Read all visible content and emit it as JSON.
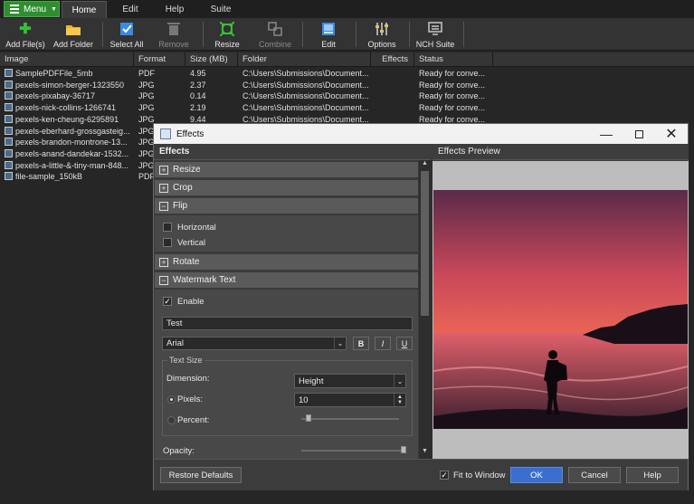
{
  "menubar": {
    "menu_label": "Menu",
    "tabs": [
      "Home",
      "Edit",
      "Help",
      "Suite"
    ]
  },
  "toolbar": {
    "buttons": [
      {
        "label": "Add File(s)",
        "icon": "add-icon",
        "enabled": true,
        "color": "#34c234"
      },
      {
        "label": "Add Folder",
        "icon": "folder-icon",
        "enabled": true,
        "color": "#f0b429"
      },
      {
        "label": "Select All",
        "icon": "select-all-icon",
        "enabled": true,
        "color": "#3a8be0"
      },
      {
        "label": "Remove",
        "icon": "remove-icon",
        "enabled": false,
        "color": "#8a8a8a"
      },
      {
        "label": "Resize",
        "icon": "resize-icon",
        "enabled": true,
        "color": "#34c234"
      },
      {
        "label": "Combine",
        "icon": "combine-icon",
        "enabled": false,
        "color": "#8a8a8a"
      },
      {
        "label": "Edit",
        "icon": "edit-icon",
        "enabled": true,
        "color": "#3a8be0"
      },
      {
        "label": "Options",
        "icon": "options-icon",
        "enabled": true,
        "color": "#d8c070"
      },
      {
        "label": "NCH Suite",
        "icon": "suite-icon",
        "enabled": true,
        "color": "#c8c8c8"
      }
    ]
  },
  "table": {
    "columns": [
      "Image",
      "Format",
      "Size (MB)",
      "Folder",
      "Effects",
      "Status"
    ],
    "rows": [
      {
        "name": "SamplePDFFile_5mb",
        "format": "PDF",
        "size": "4.95",
        "folder": "C:\\Users\\Submissions\\Document...",
        "effects": "",
        "status": "Ready for conve..."
      },
      {
        "name": "pexels-simon-berger-1323550",
        "format": "JPG",
        "size": "2.37",
        "folder": "C:\\Users\\Submissions\\Document...",
        "effects": "",
        "status": "Ready for conve..."
      },
      {
        "name": "pexels-pixabay-36717",
        "format": "JPG",
        "size": "0.14",
        "folder": "C:\\Users\\Submissions\\Document...",
        "effects": "",
        "status": "Ready for conve..."
      },
      {
        "name": "pexels-nick-collins-1266741",
        "format": "JPG",
        "size": "2.19",
        "folder": "C:\\Users\\Submissions\\Document...",
        "effects": "",
        "status": "Ready for conve..."
      },
      {
        "name": "pexels-ken-cheung-6295891",
        "format": "JPG",
        "size": "9.44",
        "folder": "C:\\Users\\Submissions\\Document...",
        "effects": "",
        "status": "Ready for conve..."
      },
      {
        "name": "pexels-eberhard-grossgasteig...",
        "format": "JPG",
        "size": "",
        "folder": "",
        "effects": "",
        "status": ""
      },
      {
        "name": "pexels-brandon-montrone-13...",
        "format": "JPG",
        "size": "",
        "folder": "",
        "effects": "",
        "status": ""
      },
      {
        "name": "pexels-anand-dandekar-1532...",
        "format": "JPG",
        "size": "",
        "folder": "",
        "effects": "",
        "status": ""
      },
      {
        "name": "pexels-a-little-&-tiny-man-848...",
        "format": "JPG",
        "size": "",
        "folder": "",
        "effects": "",
        "status": ""
      },
      {
        "name": "file-sample_150kB",
        "format": "PDF",
        "size": "",
        "folder": "",
        "effects": "",
        "status": ""
      }
    ]
  },
  "dialog": {
    "title": "Effects",
    "effects_header": "Effects",
    "preview_header": "Effects Preview",
    "sections": {
      "resize": "Resize",
      "crop": "Crop",
      "flip": "Flip",
      "rotate": "Rotate",
      "watermark": "Watermark Text"
    },
    "flip": {
      "horizontal": "Horizontal",
      "vertical": "Vertical"
    },
    "watermark": {
      "enable_label": "Enable",
      "text_value": "Test",
      "font_value": "Arial",
      "bold": "B",
      "italic": "I",
      "underline": "U",
      "text_size_label": "Text Size",
      "dimension_label": "Dimension:",
      "dimension_value": "Height",
      "pixels_label": "Pixels:",
      "pixels_value": "10",
      "percent_label": "Percent:",
      "percent_level": 0.07,
      "opacity_label": "Opacity:",
      "opacity_level": 0.99
    },
    "footer": {
      "restore_label": "Restore Defaults",
      "fit_label": "Fit to Window",
      "ok_label": "OK",
      "cancel_label": "Cancel",
      "help_label": "Help"
    }
  }
}
